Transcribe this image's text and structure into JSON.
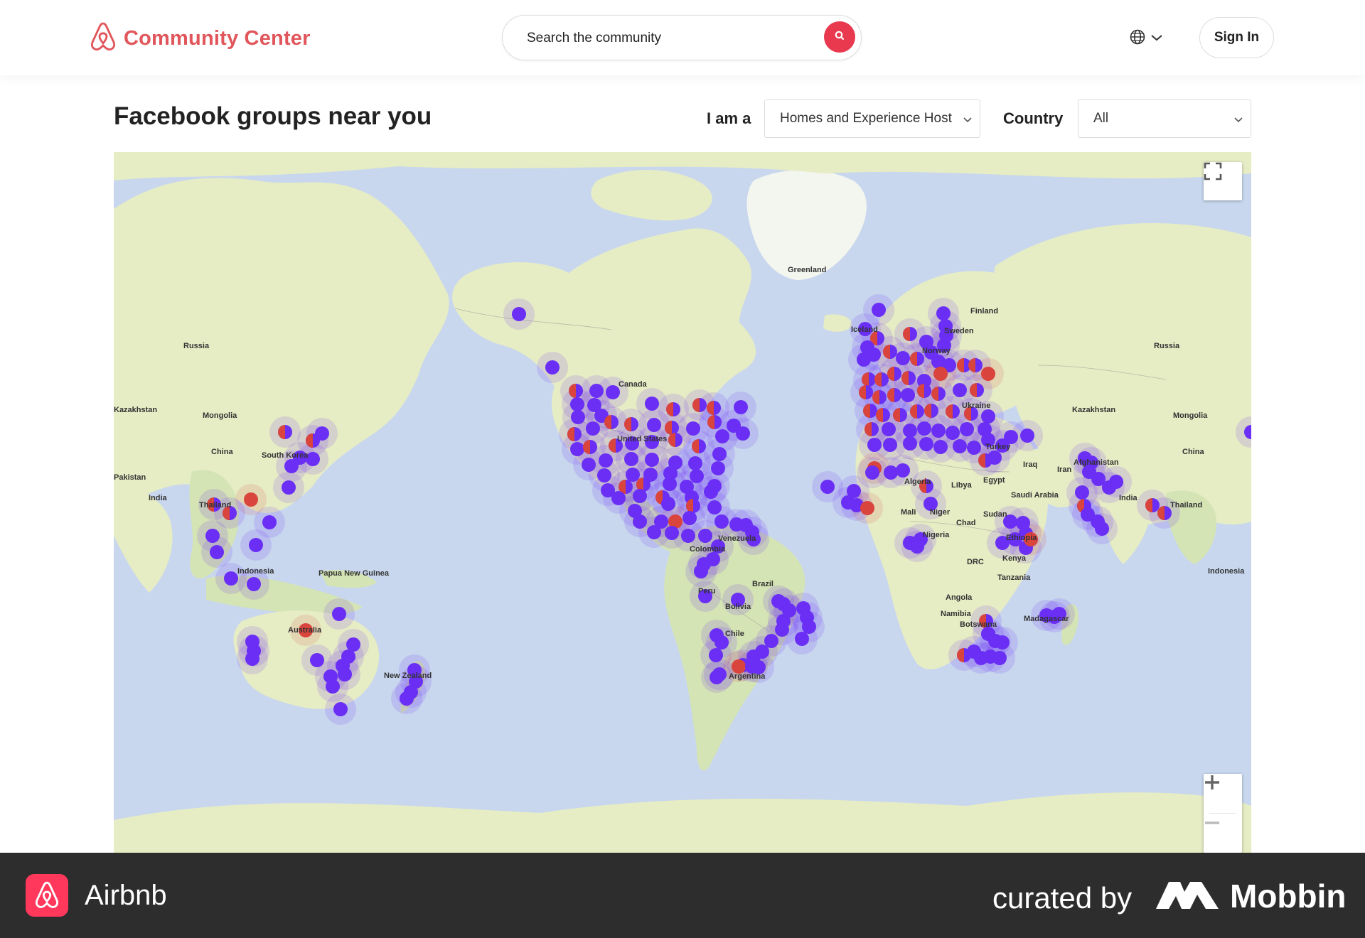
{
  "header": {
    "brand": "Community Center",
    "search_placeholder": "Search the community",
    "sign_in": "Sign In"
  },
  "page": {
    "title": "Facebook groups near you",
    "role_label": "I am a",
    "role_value": "Homes and Experience Host",
    "country_label": "Country",
    "country_value": "All"
  },
  "map": {
    "labels": [
      "Greenland",
      "Finland",
      "Sweden",
      "Norway",
      "Iceland",
      "Russia",
      "Russia",
      "Kazakhstan",
      "Kazakhstan",
      "Mongolia",
      "Mongolia",
      "China",
      "China",
      "Canada",
      "Afghanistan",
      "Pakistan",
      "India",
      "India",
      "Iran",
      "Iraq",
      "Turkey",
      "Ukraine",
      "Algeria",
      "Libya",
      "Egypt",
      "Saudi Arabia",
      "Mali",
      "Niger",
      "Chad",
      "Sudan",
      "Nigeria",
      "Ethiopia",
      "DRC",
      "Kenya",
      "Tanzania",
      "Angola",
      "Namibia",
      "Botswana",
      "Madagascar",
      "South Korea",
      "Thailand",
      "Thailand",
      "Indonesia",
      "Indonesia",
      "Papua New Guinea",
      "Australia",
      "New Zealand",
      "Venezuela",
      "Colombia",
      "Peru",
      "Brazil",
      "Bolivia",
      "Chile",
      "Argentina",
      "United States"
    ],
    "colors": {
      "water": "#c8d7ee",
      "land": "#e6ecc4",
      "land_green": "#d4e4b4",
      "ice": "#f3f5ef",
      "marker_purple": "#6a2ef5",
      "marker_red": "#d9443d"
    }
  },
  "footer": {
    "app_name": "Airbnb",
    "curated_by": "curated by",
    "mobbin": "Mobbin"
  }
}
